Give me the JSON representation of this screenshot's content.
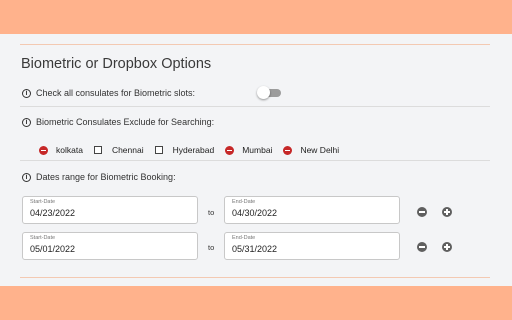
{
  "section": {
    "title": "Biometric or Dropbox Options"
  },
  "check_all": {
    "label": "Check all consulates for Biometric slots:",
    "enabled": false
  },
  "exclude": {
    "label": "Biometric Consulates Exclude for Searching:",
    "options": [
      {
        "label": "kolkata",
        "excluded": true
      },
      {
        "label": "Chennai",
        "excluded": false
      },
      {
        "label": "Hyderabad",
        "excluded": false
      },
      {
        "label": "Mumbai",
        "excluded": true
      },
      {
        "label": "New Delhi",
        "excluded": true
      }
    ]
  },
  "dates": {
    "label": "Dates range for Biometric Booking:",
    "start_label": "Start-Date",
    "end_label": "End-Date",
    "to_label": "to",
    "ranges": [
      {
        "start": "04/23/2022",
        "end": "04/30/2022"
      },
      {
        "start": "05/01/2022",
        "end": "05/31/2022"
      }
    ]
  },
  "colors": {
    "accent": "#ffb28c",
    "excluded": "#c62828"
  }
}
